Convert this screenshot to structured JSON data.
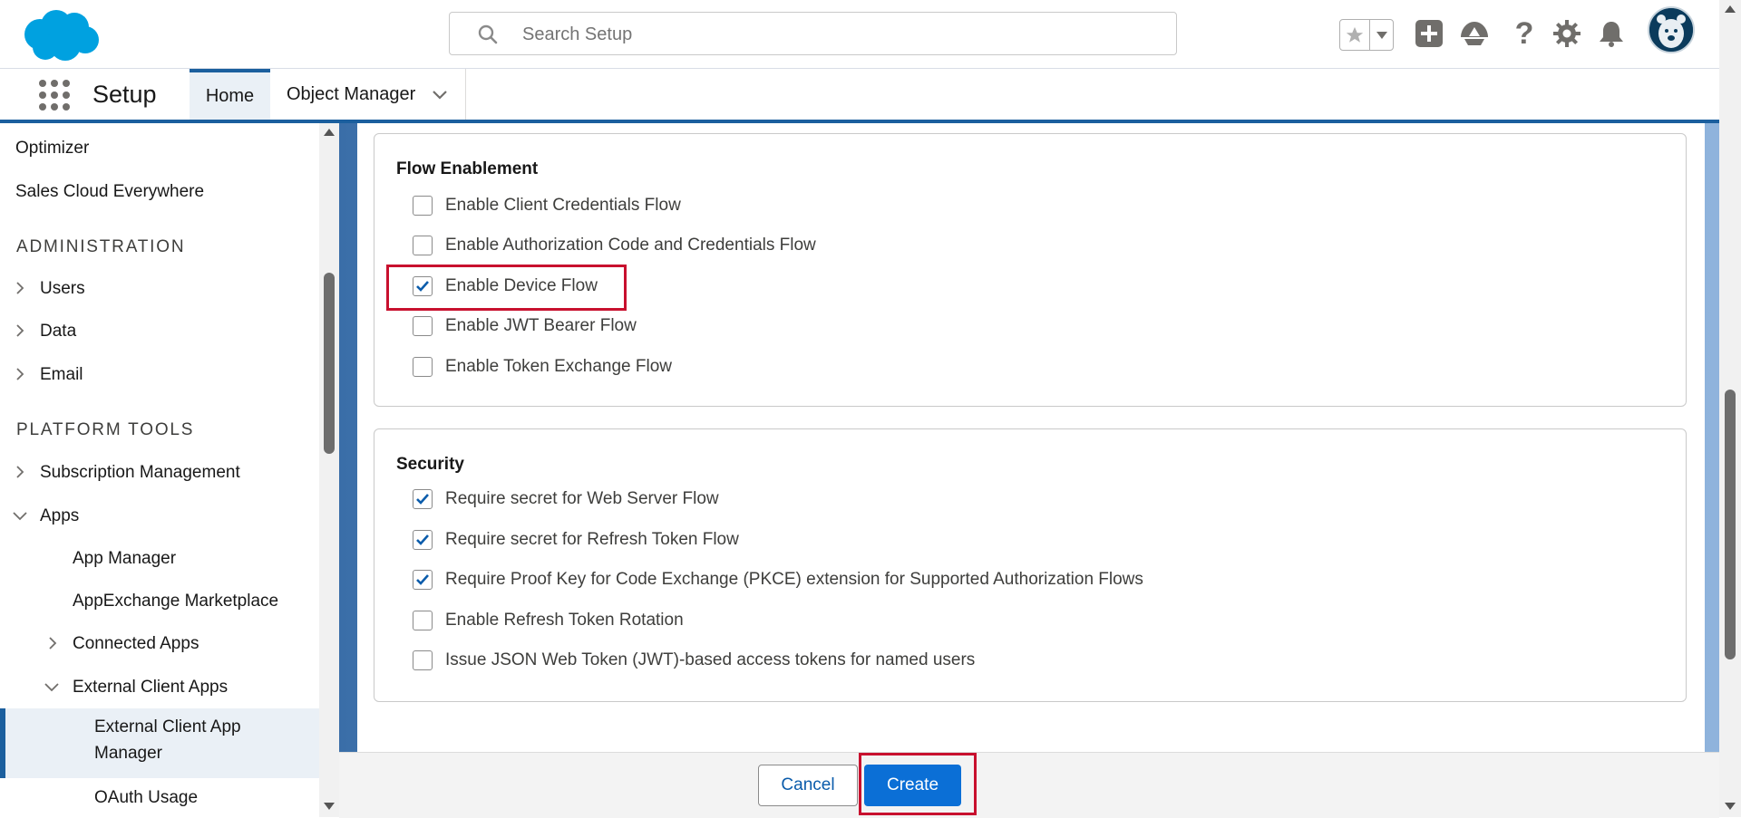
{
  "header": {
    "search_placeholder": "Search Setup",
    "icons": [
      "salesforce-cloud-logo",
      "search-icon",
      "favorites-star-icon",
      "favorites-dropdown-icon",
      "global-actions-add-icon",
      "trailhead-icon",
      "help-icon",
      "setup-gear-icon",
      "notifications-bell-icon",
      "user-avatar"
    ]
  },
  "nav": {
    "app_name": "Setup",
    "tabs": [
      {
        "label": "Home",
        "active": true
      },
      {
        "label": "Object Manager",
        "active": false
      }
    ]
  },
  "sidebar": {
    "items": {
      "optimizer": "Optimizer",
      "sales_cloud_everywhere": "Sales Cloud Everywhere",
      "administration": "ADMINISTRATION",
      "users": "Users",
      "data": "Data",
      "email": "Email",
      "platform_tools": "PLATFORM TOOLS",
      "subscription_management": "Subscription Management",
      "apps": "Apps",
      "app_manager": "App Manager",
      "appexchange": "AppExchange Marketplace",
      "connected_apps": "Connected Apps",
      "external_client_apps": "External Client Apps",
      "external_client_app_manager_line1": "External Client App",
      "external_client_app_manager_line2": "Manager",
      "oauth_usage": "OAuth Usage"
    },
    "selected": "External Client App Manager"
  },
  "flow_enablement": {
    "title": "Flow Enablement",
    "options": [
      {
        "label": "Enable Client Credentials Flow",
        "checked": false
      },
      {
        "label": "Enable Authorization Code and Credentials Flow",
        "checked": false
      },
      {
        "label": "Enable Device Flow",
        "checked": true
      },
      {
        "label": "Enable JWT Bearer Flow",
        "checked": false
      },
      {
        "label": "Enable Token Exchange Flow",
        "checked": false
      }
    ]
  },
  "security": {
    "title": "Security",
    "options": [
      {
        "label": "Require secret for Web Server Flow",
        "checked": true
      },
      {
        "label": "Require secret for Refresh Token Flow",
        "checked": true
      },
      {
        "label": "Require Proof Key for Code Exchange (PKCE) extension for Supported Authorization Flows",
        "checked": true
      },
      {
        "label": "Enable Refresh Token Rotation",
        "checked": false
      },
      {
        "label": "Issue JSON Web Token (JWT)-based access tokens for named users",
        "checked": false
      }
    ]
  },
  "footer": {
    "cancel_label": "Cancel",
    "create_label": "Create"
  },
  "colors": {
    "brand_blue": "#0b6fd6",
    "nav_accent": "#1b5f9e",
    "highlight_red": "#c8102e",
    "checkmark": "#0b5cab"
  }
}
